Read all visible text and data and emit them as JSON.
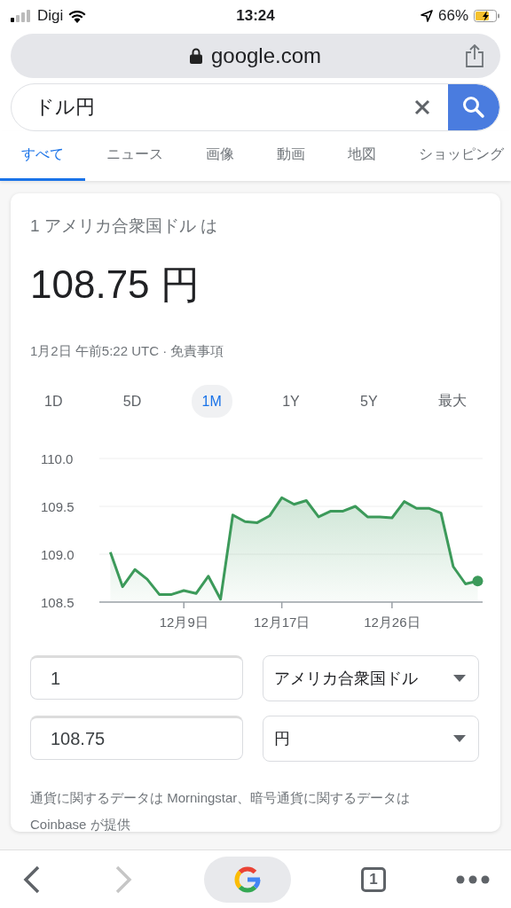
{
  "status_bar": {
    "carrier": "Digi",
    "time": "13:24",
    "battery": "66%"
  },
  "address_bar": {
    "url": "google.com"
  },
  "search": {
    "value": "ドル円"
  },
  "tabs": [
    {
      "label": "すべて",
      "selected": true
    },
    {
      "label": "ニュース",
      "selected": false
    },
    {
      "label": "画像",
      "selected": false
    },
    {
      "label": "動画",
      "selected": false
    },
    {
      "label": "地図",
      "selected": false
    },
    {
      "label": "ショッピング",
      "selected": false
    }
  ],
  "card": {
    "subtitle": "1 アメリカ合衆国ドル は",
    "result": "108.75 円",
    "timestamp": "1月2日 午前5:22 UTC · ",
    "disclaimer_link": "免責事項",
    "ranges": [
      {
        "label": "1D",
        "selected": false
      },
      {
        "label": "5D",
        "selected": false
      },
      {
        "label": "1M",
        "selected": true
      },
      {
        "label": "1Y",
        "selected": false
      },
      {
        "label": "5Y",
        "selected": false
      },
      {
        "label": "最大",
        "selected": false
      }
    ],
    "chart_data": {
      "type": "area",
      "categories": [
        null,
        null,
        null,
        null,
        null,
        null,
        "12月9日",
        null,
        null,
        null,
        null,
        null,
        null,
        null,
        "12月17日",
        null,
        null,
        null,
        null,
        null,
        null,
        null,
        null,
        "12月26日",
        null,
        null,
        null,
        null,
        null,
        null,
        null
      ],
      "series": [
        {
          "color": "#3c9a5a",
          "values": [
            109.02,
            108.66,
            108.84,
            108.74,
            108.58,
            108.58,
            108.62,
            108.59,
            108.77,
            108.53,
            109.41,
            109.34,
            109.33,
            109.4,
            109.59,
            109.52,
            109.56,
            109.39,
            109.45,
            109.45,
            109.5,
            109.39,
            109.39,
            109.38,
            109.55,
            109.48,
            109.48,
            109.43,
            108.87,
            108.69,
            108.72
          ]
        }
      ],
      "ylim": [
        108.5,
        110.0
      ],
      "yticks": [
        {
          "value": 110.0,
          "label": "110.0"
        },
        {
          "value": 109.5,
          "label": "109.5"
        },
        {
          "value": 109.0,
          "label": "109.0"
        },
        {
          "value": 108.5,
          "label": "108.5"
        }
      ]
    },
    "converter": [
      {
        "amount": "1",
        "currency": "アメリカ合衆国ドル"
      },
      {
        "amount": "108.75",
        "currency": "円"
      }
    ],
    "source_note": "通貨に関するデータは Morningstar、暗号通貨に関するデータは Coinbase が提供"
  },
  "toolbar": {
    "tab_count": "1",
    "forward_disabled": true
  }
}
